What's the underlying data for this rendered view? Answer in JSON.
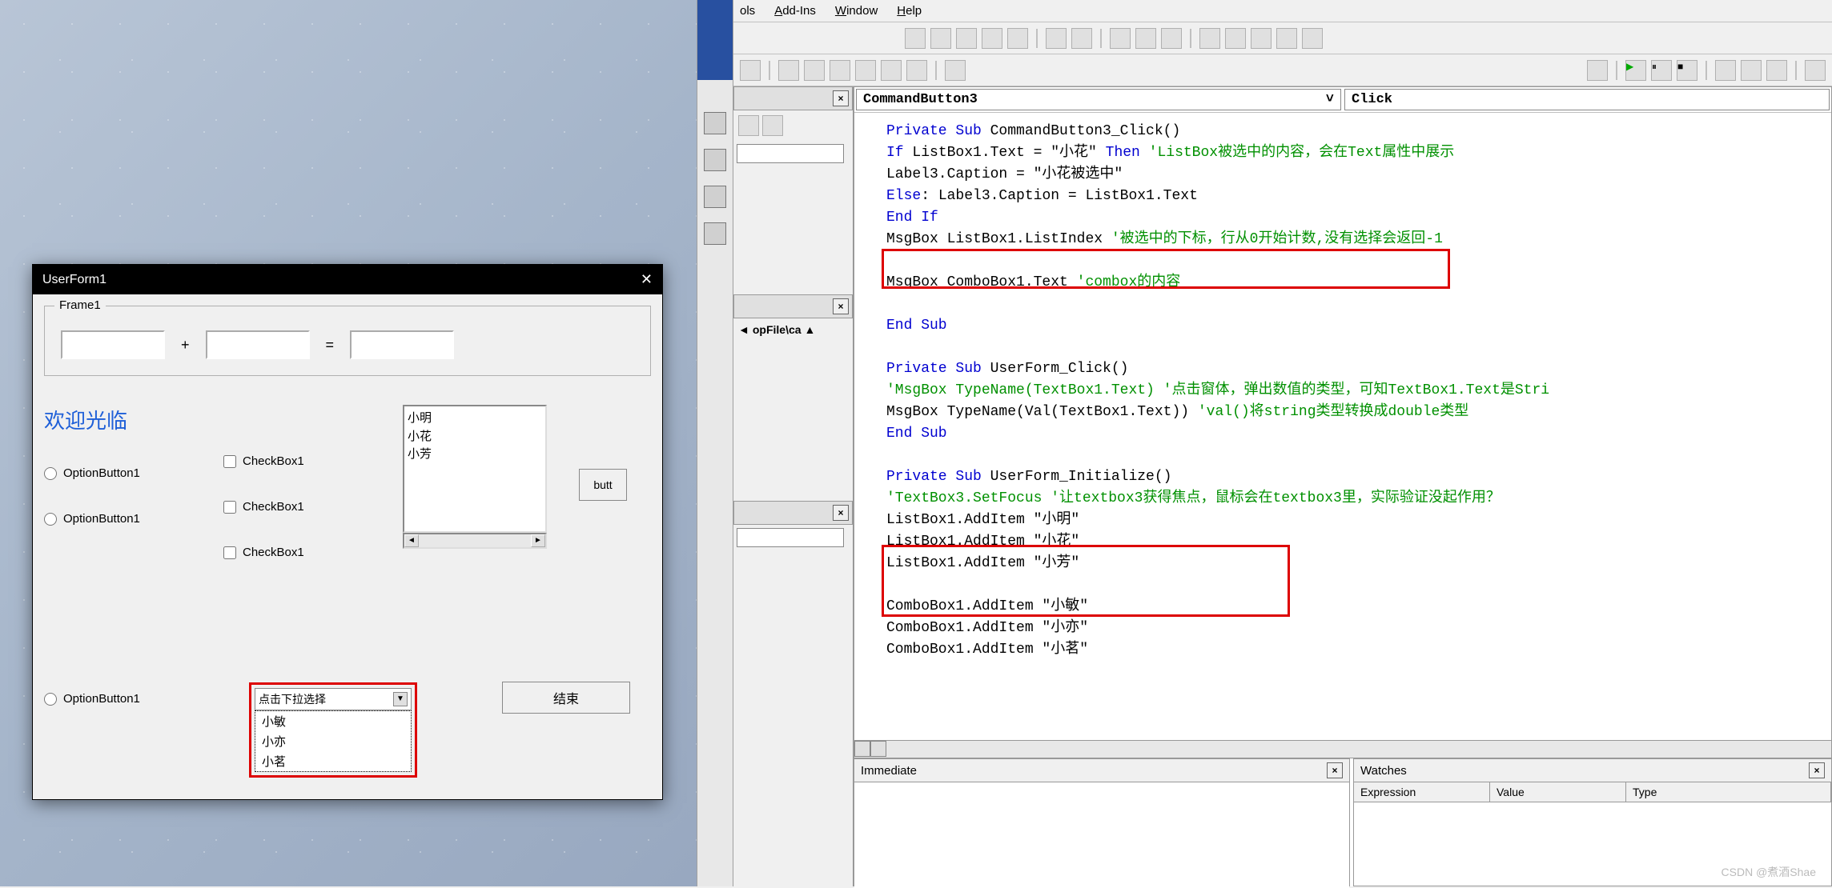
{
  "userform": {
    "title": "UserForm1",
    "frame_label": "Frame1",
    "plus": "+",
    "equals": "=",
    "welcome": "欢迎光临",
    "option_label": "OptionButton1",
    "checkbox_label": "CheckBox1",
    "listbox_items": [
      "小明",
      "小花",
      "小芳"
    ],
    "butt_label": "butt",
    "combobox_text": "点击下拉选择",
    "combobox_items": [
      "小敏",
      "小亦",
      "小茗"
    ],
    "end_button": "结束"
  },
  "vb": {
    "menu": {
      "tools": "ols",
      "addins": "Add-Ins",
      "window": "Window",
      "help": "Help"
    },
    "proc_left": "CommandButton3",
    "proc_right": "Click",
    "path_fragment": "opFile\\ca",
    "immediate_title": "Immediate",
    "watches_title": "Watches",
    "watch_cols": {
      "expr": "Expression",
      "value": "Value",
      "type": "Type"
    }
  },
  "code": {
    "l01a": "Private Sub",
    "l01b": " CommandButton3_Click()",
    "l02a": "If",
    "l02b": " ListBox1.Text = \"小花\" ",
    "l02c": "Then ",
    "l02d": "'ListBox被选中的内容，会在Text属性中展示",
    "l03": "Label3.Caption = \"小花被选中\"",
    "l04a": "Else",
    "l04b": ": Label3.Caption = ListBox1.Text",
    "l05": "End If",
    "l06a": "MsgBox ListBox1.ListIndex ",
    "l06b": "'被选中的下标，行从0开始计数,没有选择会返回-1",
    "l07": "",
    "l08a": "MsgBox ComboBox1.Text ",
    "l08b": "'combox的内容",
    "l09": "",
    "l10": "End Sub",
    "l11": "",
    "l12a": "Private Sub",
    "l12b": " UserForm_Click()",
    "l13": "'MsgBox TypeName(TextBox1.Text) '点击窗体，弹出数值的类型，可知TextBox1.Text是Stri",
    "l14a": "MsgBox TypeName(Val(TextBox1.Text)) ",
    "l14b": "'val()将string类型转换成double类型",
    "l15": "End Sub",
    "l16": "",
    "l17a": "Private Sub",
    "l17b": " UserForm_Initialize()",
    "l18": "'TextBox3.SetFocus '让textbox3获得焦点，鼠标会在textbox3里，实际验证没起作用？",
    "l19": "ListBox1.AddItem \"小明\"",
    "l20": "ListBox1.AddItem \"小花\"",
    "l21": "ListBox1.AddItem \"小芳\"",
    "l22": "",
    "l23": "ComboBox1.AddItem \"小敏\"",
    "l24": "ComboBox1.AddItem \"小亦\"",
    "l25": "ComboBox1.AddItem \"小茗\""
  },
  "watermark": "CSDN @煮酒Shae"
}
